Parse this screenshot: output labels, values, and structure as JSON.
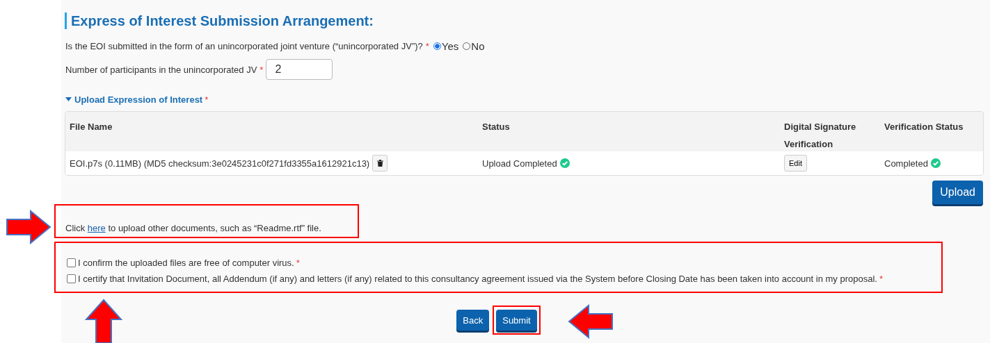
{
  "title": "Express of Interest Submission Arrangement:",
  "jv_question": {
    "label": "Is the EOI submitted in the form of an unincorporated joint venture (“unincorporated JV”)?",
    "required_mark": "*",
    "options": [
      {
        "label": "Yes",
        "selected": true
      },
      {
        "label": "No",
        "selected": false
      }
    ]
  },
  "participants": {
    "label": "Number of participants in the unincorporated JV",
    "required_mark": "*",
    "value": "2"
  },
  "upload_section": {
    "title": "Upload Expression of Interest",
    "required_mark": "*",
    "expanded": true
  },
  "table": {
    "columns": [
      "File Name",
      "Status",
      "Digital Signature Verification",
      "Verification Status"
    ],
    "rows": [
      {
        "file_name": "EOI.p7s (0.11MB) (MD5 checksum:3e0245231c0f271fd3355a1612921c13)",
        "status": "Upload Completed",
        "edit_button": "Edit",
        "verification_status": "Completed"
      }
    ]
  },
  "upload_button": "Upload",
  "other_docs": {
    "before": "Click",
    "link": "here",
    "after": "to upload other documents, such as “Readme.rtf” file.",
    "highlighted": true
  },
  "confirmations_highlighted": true,
  "confirmations": [
    {
      "label": "I confirm the uploaded files are free of computer virus.",
      "required_mark": "*",
      "checked": false
    },
    {
      "label": "I certify that Invitation Document, all Addendum (if any) and letters (if any) related to this consultancy agreement issued via the System before Closing Date has been taken into account in my proposal.",
      "required_mark": "*",
      "checked": false
    }
  ],
  "buttons": [
    {
      "label": "Back",
      "highlighted": false
    },
    {
      "label": "Submit",
      "highlighted": true
    }
  ],
  "arrows": [
    {
      "kind": "right"
    },
    {
      "kind": "up"
    },
    {
      "kind": "left"
    }
  ]
}
